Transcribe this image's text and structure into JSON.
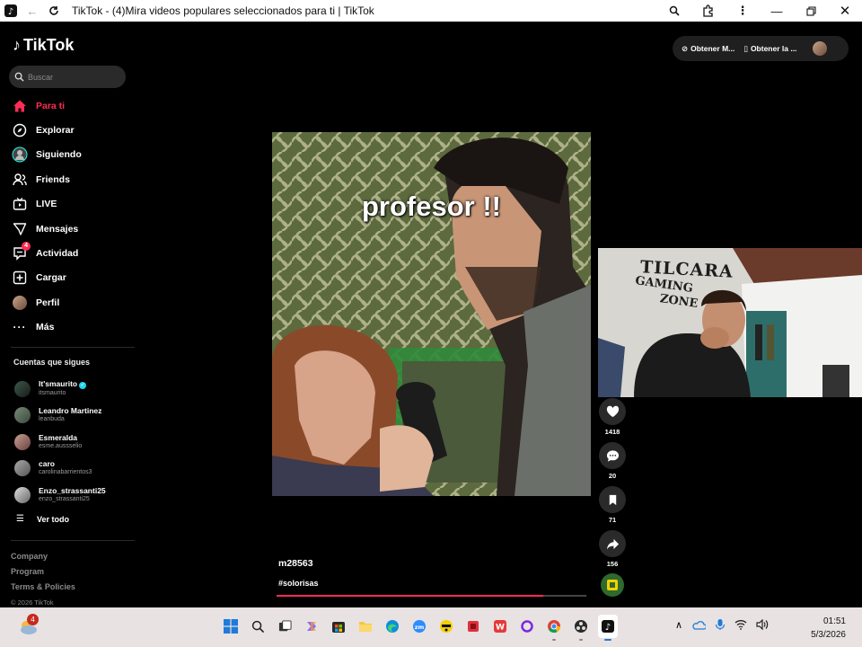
{
  "window": {
    "title": "TikTok - (4)Mira videos populares seleccionados para ti | TikTok"
  },
  "sidebar": {
    "brand": "TikTok",
    "search_placeholder": "Buscar",
    "nav": [
      {
        "label": "Para ti",
        "icon": "home-icon",
        "active": true
      },
      {
        "label": "Explorar",
        "icon": "compass-icon"
      },
      {
        "label": "Siguiendo",
        "icon": "following-icon"
      },
      {
        "label": "Friends",
        "icon": "friends-icon"
      },
      {
        "label": "LIVE",
        "icon": "live-icon"
      },
      {
        "label": "Mensajes",
        "icon": "send-icon"
      },
      {
        "label": "Actividad",
        "icon": "activity-icon",
        "badge": "4"
      },
      {
        "label": "Cargar",
        "icon": "upload-icon"
      },
      {
        "label": "Perfil",
        "icon": "profile-avatar"
      },
      {
        "label": "Más",
        "icon": "more-icon"
      }
    ],
    "following_title": "Cuentas que sigues",
    "following": [
      {
        "name": "It'smaurito",
        "username": "itsmaurito",
        "verified": true
      },
      {
        "name": "Leandro Martinez",
        "username": "leanbuda"
      },
      {
        "name": "Esmeralda",
        "username": "esme.aussselio"
      },
      {
        "name": "caro",
        "username": "carolinabarrientos3"
      },
      {
        "name": "Enzo_strassanti25",
        "username": "enzo_strassanti25"
      }
    ],
    "see_all": "Ver todo",
    "footer": {
      "company": "Company",
      "program": "Program",
      "terms": "Terms & Policies",
      "copyright": "© 2026 TikTok"
    }
  },
  "header": {
    "get_app_1": "Obtener M...",
    "get_app_2": "Obtener la ..."
  },
  "video": {
    "caption_overlay": "profesor !!",
    "author": "m28563",
    "hashtag": "#solorisas",
    "progress": 0.86
  },
  "actions": {
    "likes": "1418",
    "comments": "20",
    "saves": "71",
    "shares": "156"
  },
  "webcam": {
    "sign_line1": "TILCARA",
    "sign_line2": "GAMING",
    "sign_line3": "ZONE"
  },
  "taskbar": {
    "notification_count": "4",
    "time": "01:51",
    "date": "5/3/2026"
  },
  "colors": {
    "accent": "#fe2c55",
    "background": "#000000",
    "taskbar": "#e8e2e2"
  }
}
